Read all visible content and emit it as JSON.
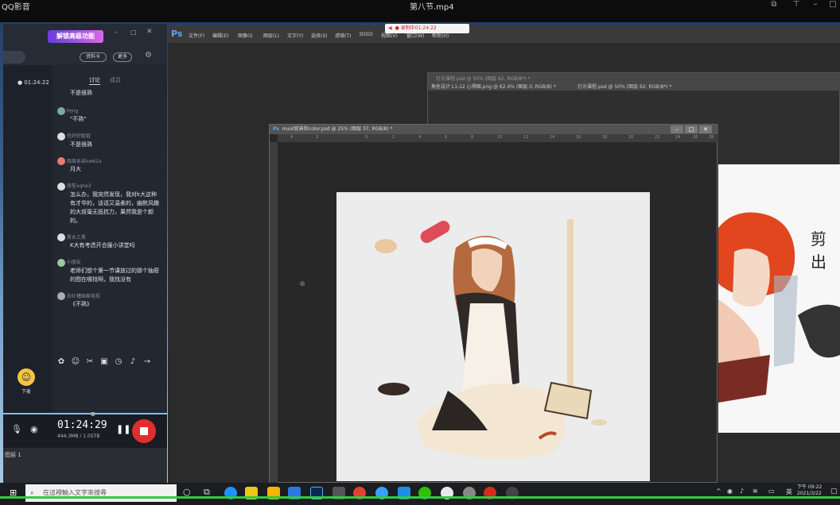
{
  "player": {
    "app_name": "QQ影音",
    "file_title": "第八节.mp4"
  },
  "chat": {
    "banner": "解锁高级功能",
    "btn_profile": "资料卡",
    "btn_more": "更多",
    "live_time": "● 01:24:22",
    "tab_discuss": "讨论",
    "tab_other": "成员",
    "messages": [
      {
        "name": "",
        "text": "不是很熟"
      },
      {
        "name": "Feng",
        "text": "\"不熟\""
      },
      {
        "name": "也好好姐姐",
        "text": "不是很熟"
      },
      {
        "name": "周周亲亲kw62a",
        "text": "月大"
      },
      {
        "name": "南笙xqhe3",
        "text": "怎么办，我突然发现，我对k大这种有才华的，谈话又温柔的，幽默风趣的大叔毫无抵抗力，果然我是个颜的。"
      },
      {
        "name": "黑水三黑",
        "text": "K大有考虑开合服小讲堂吗"
      },
      {
        "name": "小朋友",
        "text": "老师们想个第一节课放过的那个抽屉的图在哪找啊，我找没有"
      },
      {
        "name": "去吐槽国家电视",
        "text": "《不熟》"
      }
    ],
    "raise_hand_label": "下麦"
  },
  "recorder": {
    "time": "01:24:29",
    "size": "444.3MB / 1.05TB"
  },
  "layers_label": "图层 1",
  "photoshop": {
    "logo": "Ps",
    "menus": [
      "文件(F)",
      "编辑(E)",
      "图像(I)",
      "图层(L)",
      "文字(Y)",
      "选择(S)",
      "滤镜(T)",
      "3D(D)",
      "视图(V)",
      "窗口(W)",
      "帮助(H)"
    ],
    "record_badge": "● 录制中01:24:22",
    "back_doc_title": "灯光课程.psd @ 50% (图层 62, RGB/8*) *",
    "back_tabs": [
      "角色设计 L1-12 心得图.png @ 62.4% (图层 0, RGB/8) *",
      "灯光课程.psd @ 50% (图层 62, RGB/8*) *"
    ],
    "doc_title": "maid背景和color.psd @ 25% (图层 37, RGB/8) *",
    "ruler_marks": [
      "4",
      "2",
      "0",
      "2",
      "4",
      "6",
      "8",
      "10",
      "12",
      "14",
      "16",
      "18",
      "20",
      "22",
      "24",
      "26",
      "28"
    ],
    "right_art_text": "剪出"
  },
  "taskbar": {
    "search_placeholder": "在這裡輸入文字來搜尋",
    "ime": "英",
    "time": "下午 09:22",
    "date": "2021/3/22"
  }
}
